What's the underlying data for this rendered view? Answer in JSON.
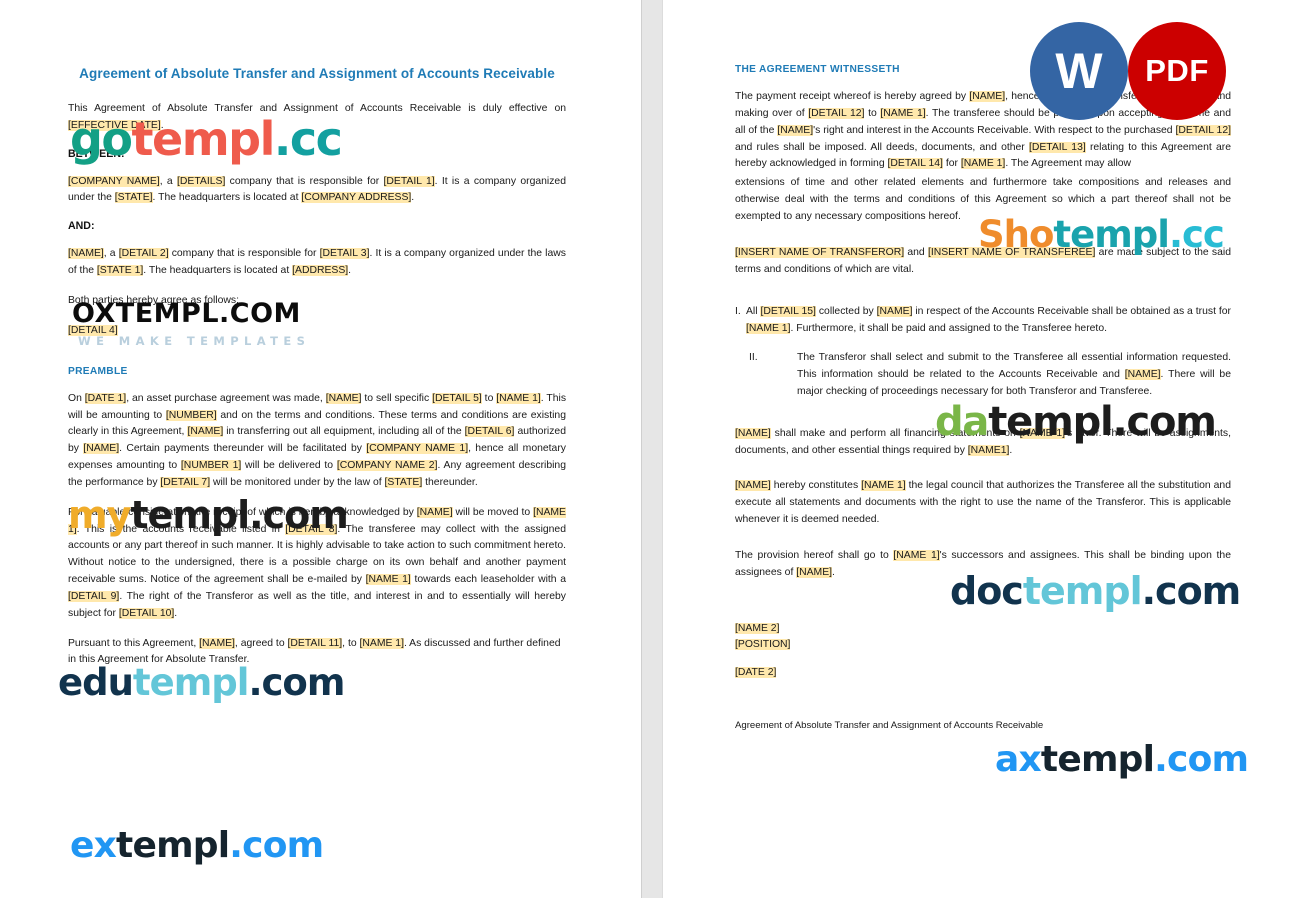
{
  "document": {
    "title": "Agreement of Absolute Transfer and Assignment of Accounts Receivable",
    "footer": "Agreement of Absolute Transfer and Assignment of Accounts Receivable"
  },
  "badges": [
    {
      "name": "word-badge",
      "label": "W",
      "color": "#3465a4"
    },
    {
      "name": "pdf-badge",
      "label": "PDF",
      "color": "#cc0000"
    }
  ],
  "page_left": {
    "intro": {
      "pre": "This Agreement of Absolute Transfer and Assignment of Accounts Receivable is duly effective on ",
      "field": "[EFFECTIVE DATE]",
      "post": "."
    },
    "between_label": "BETWEEN:",
    "party_one": {
      "f1": "[COMPANY NAME]",
      "t1": ", a ",
      "f2": "[DETAILS]",
      "t2": " company that is responsible for ",
      "f3": "[DETAIL 1]",
      "t3": ". It is a company organized under the ",
      "f4": "[STATE]",
      "t4": ". The headquarters is located at ",
      "f5": "[COMPANY ADDRESS]",
      "t5": "."
    },
    "and_label": "AND:",
    "party_two": {
      "f1": "[NAME]",
      "t1": ", a ",
      "f2": "[DETAIL 2]",
      "t2": " company that is responsible for ",
      "f3": "[DETAIL 3]",
      "t3": ". It is a company organized under the laws of the ",
      "f4": "[STATE 1]",
      "t4": ". The headquarters is located at ",
      "f5": "[ADDRESS]",
      "t5": "."
    },
    "agree_line": "Both parties hereby agree as follows:",
    "detail_4": "[DETAIL 4]",
    "preamble_heading": "PREAMBLE",
    "preamble_p1": {
      "t0": "On ",
      "f1": "[DATE 1]",
      "t1": ", an asset purchase agreement was made, ",
      "f2": "[NAME]",
      "t2": " to sell specific ",
      "f3": "[DETAIL 5]",
      "t3": " to ",
      "f4": "[NAME 1]",
      "t4": ". This will be amounting to ",
      "f5": "[NUMBER]",
      "t5": " and on the terms and conditions. These terms and conditions are existing clearly in this Agreement, ",
      "f6": "[NAME]",
      "t6": " in transferring out all equipment, including all of the ",
      "f7": "[DETAIL 6]",
      "t7": " authorized by ",
      "f8": "[NAME]",
      "t8": ". Certain payments thereunder will be facilitated by ",
      "f9": "[COMPANY NAME 1]",
      "t9": ", hence all monetary expenses amounting to ",
      "f10": "[NUMBER 1]",
      "t10": " will be delivered to ",
      "f11": "[COMPANY NAME 2]",
      "t11": ". Any agreement describing the performance by ",
      "f12": "[DETAIL 7]",
      "t12": " will be monitored under by the law of ",
      "f13": "[STATE]",
      "t13": " thereunder."
    },
    "preamble_p2": {
      "t0": "For valuable consideration, the receipt of which is hereby acknowledged by ",
      "f1": "[NAME]",
      "t1": " will be moved to ",
      "f2": "[NAME 1]",
      "t2": ". This is the accounts receivable listed in ",
      "f3": "[DETAIL 8]",
      "t3": ". The transferee may collect with the assigned accounts or any part thereof in such manner. It is highly advisable to take action to such commitment hereto. Without notice to the undersigned, there is a possible charge on its own behalf and another payment receivable sums. Notice of the agreement shall be e-mailed by ",
      "f4": "[NAME 1]",
      "t4": " towards each leaseholder with a ",
      "f5": "[DETAIL 9]",
      "t5": ". The right of the Transferor as well as the title, and interest in and to essentially will hereby subject for ",
      "f6": "[DETAIL 10]",
      "t6": "."
    },
    "preamble_p3": {
      "t0": "Pursuant to this Agreement, ",
      "f1": "[NAME]",
      "t1": ", agreed to ",
      "f2": "[DETAIL 11]",
      "t2": ", to ",
      "f3": "[NAME 1]",
      "t3": ". As discussed and further defined in this Agreement for Absolute Transfer."
    }
  },
  "page_right": {
    "witnesseth_heading": "THE AGREEMENT WITNESSETH",
    "witness_p1": {
      "t0": "The payment receipt whereof is hereby agreed by ",
      "f1": "[NAME]",
      "t1": ", hence, there will be transferring, assigning, and making over of ",
      "f2": "[DETAIL 12]",
      "t2": " to ",
      "f3": "[NAME 1]",
      "t3": ". The transferee should be present upon accepting the same and all of the ",
      "f4": "[NAME]",
      "t4": "'s right and interest in the Accounts Receivable. With respect to the purchased ",
      "f5": "[DETAIL 12]",
      "t5": " and  rules shall be imposed. All deeds, documents, and other ",
      "f6": "[DETAIL 13]",
      "t6": " relating to this Agreement are hereby acknowledged in forming ",
      "f7": "[DETAIL 14]",
      "t7": " for ",
      "f8": "[NAME 1]",
      "t8": ". The Agreement may allow"
    },
    "witness_p1b": "extensions of time and other related elements and furthermore take compositions and releases and otherwise deal with the terms and conditions of this Agreement so which a part thereof shall not be exempted to any necessary compositions hereof.",
    "witness_p2": {
      "f1": "[INSERT NAME OF TRANSFEROR]",
      "t1": " and ",
      "f2": "[INSERT NAME OF TRANSFEREE]",
      "t2": " are made subject to the said terms and conditions of which are vital."
    },
    "item_1": {
      "num": "I.",
      "t0": "All ",
      "f1": "[DETAIL 15]",
      "t1": " collected by ",
      "f2": "[NAME]",
      "t2": " in respect of the Accounts Receivable shall be obtained as a trust for ",
      "f3": "[NAME 1]",
      "t3": ". Furthermore, it shall be paid and assigned to the Transferee hereto."
    },
    "item_2": {
      "num": "II.",
      "t0": "The Transferor shall select and submit to the Transferee all essential information requested. This information should be related to the Accounts Receivable and ",
      "f1": "[NAME]",
      "t1": ". There will be major checking of proceedings necessary for both Transferor and Transferee."
    },
    "p_financing": {
      "f1": "[NAME]",
      "t1": " shall make and perform all financing statements on ",
      "f2": "[NAME 1]",
      "t2": "'s favor. There will be assignments, documents, and other essential things required by ",
      "f3": "[NAME1]",
      "t3": "."
    },
    "p_council": {
      "f1": "[NAME]",
      "t1": " hereby constitutes ",
      "f2": "[NAME 1]",
      "t2": " the legal council that authorizes the Transferee all the substitution and execute all statements and documents with the right to use the name of the Transferor. This is applicable whenever it is deemed needed."
    },
    "p_provision": {
      "t0": "The provision hereof shall go to ",
      "f1": "[NAME 1]",
      "t1": "'s successors and assignees. This shall be binding upon the assignees of ",
      "f2": "[NAME]",
      "t2": "."
    },
    "signature": {
      "name": "[NAME 2]",
      "position": "[POSITION]",
      "date": "[DATE 2]"
    }
  },
  "watermarks": [
    {
      "name": "gotempl-watermark",
      "a": "go",
      "b": "templ",
      "c": ".cc",
      "colors": [
        "#13a085",
        "#ef5b4c",
        "#13a0a0"
      ]
    },
    {
      "name": "oxtempl-watermark",
      "a": "OXTEMPL.COM",
      "sub": "WE MAKE TEMPLATES",
      "colors": [
        "#0c0c0c",
        "#b9cfdd"
      ]
    },
    {
      "name": "mytempl-watermark",
      "a": "my",
      "b": "templ",
      "c": ".com",
      "colors": [
        "#f0ac2a",
        "#1d1d1d",
        "#1d1d1d"
      ]
    },
    {
      "name": "edutempl-watermark",
      "a": "edu",
      "b": "templ",
      "c": ".com",
      "colors": [
        "#11334d",
        "#63c6d8",
        "#11334d"
      ]
    },
    {
      "name": "extempl-watermark",
      "a": "ex",
      "b": "templ",
      "c": ".com",
      "colors": [
        "#2196f3",
        "#15242e",
        "#2196f3"
      ]
    },
    {
      "name": "shotempl-watermark",
      "a": "Sho",
      "b": "templ",
      "c": ".cc",
      "colors": [
        "#ef8c2c",
        "#1aa3ad",
        "#28bcd4"
      ]
    },
    {
      "name": "datempl-watermark",
      "a": "da",
      "b": "templ",
      "c": ".com",
      "colors": [
        "#7ab648",
        "#1d1d1d",
        "#1d1d1d"
      ]
    },
    {
      "name": "doctempl-watermark",
      "a": "doc",
      "b": "templ",
      "c": ".com",
      "colors": [
        "#11334d",
        "#63c6d8",
        "#11334d"
      ]
    },
    {
      "name": "axtempl-watermark",
      "a": "ax",
      "b": "templ",
      "c": ".com",
      "colors": [
        "#2196f3",
        "#15242e",
        "#2196f3"
      ]
    }
  ]
}
